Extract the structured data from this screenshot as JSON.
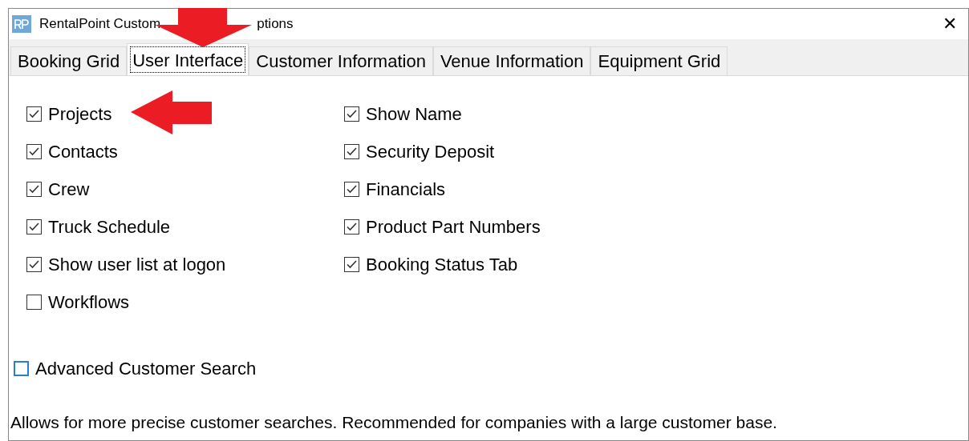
{
  "window": {
    "title_parts": [
      "RentalPoint Custom",
      "ptions"
    ],
    "close": "✕"
  },
  "tabs": [
    {
      "label": "Booking Grid",
      "selected": false
    },
    {
      "label": "User Interface",
      "selected": true
    },
    {
      "label": "Customer Information",
      "selected": false
    },
    {
      "label": "Venue Information",
      "selected": false
    },
    {
      "label": "Equipment Grid",
      "selected": false
    }
  ],
  "options_left": [
    {
      "label": "Projects",
      "checked": true
    },
    {
      "label": "Contacts",
      "checked": true
    },
    {
      "label": "Crew",
      "checked": true
    },
    {
      "label": "Truck Schedule",
      "checked": true
    },
    {
      "label": "Show user list at logon",
      "checked": true
    },
    {
      "label": "Workflows",
      "checked": false
    }
  ],
  "options_right": [
    {
      "label": "Show Name",
      "checked": true
    },
    {
      "label": "Security Deposit",
      "checked": true
    },
    {
      "label": "Financials",
      "checked": true
    },
    {
      "label": "Product Part Numbers",
      "checked": true
    },
    {
      "label": "Booking Status Tab",
      "checked": true
    }
  ],
  "advanced": {
    "label": "Advanced Customer Search",
    "checked": false,
    "hovered": true
  },
  "description": "Allows for more precise customer searches. Recommended for companies with a large customer base."
}
